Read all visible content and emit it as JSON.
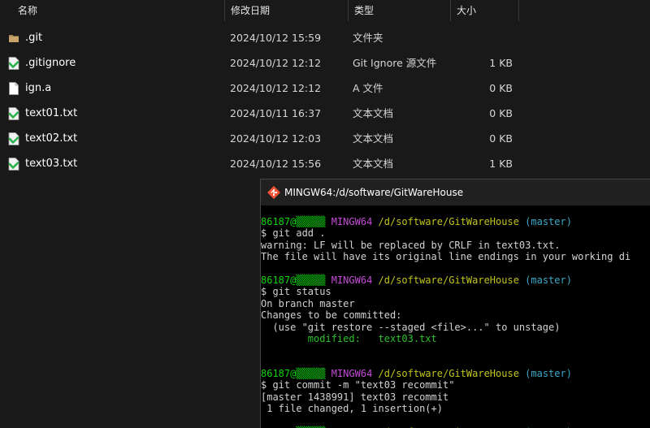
{
  "explorer": {
    "columns": {
      "name": "名称",
      "modified": "修改日期",
      "type": "类型",
      "size": "大小"
    },
    "sort_indicator": "^",
    "files": [
      {
        "name": ".git",
        "modified": "2024/10/12 15:59",
        "type": "文件夹",
        "size": "",
        "icon": "folder-icon"
      },
      {
        "name": ".gitignore",
        "modified": "2024/10/12 12:12",
        "type": "Git Ignore 源文件",
        "size": "1 KB",
        "icon": "git-file-icon"
      },
      {
        "name": "ign.a",
        "modified": "2024/10/12 12:12",
        "type": "A 文件",
        "size": "0 KB",
        "icon": "blank-file-icon"
      },
      {
        "name": "text01.txt",
        "modified": "2024/10/11 16:37",
        "type": "文本文档",
        "size": "0 KB",
        "icon": "git-file-icon"
      },
      {
        "name": "text02.txt",
        "modified": "2024/10/12 12:03",
        "type": "文本文档",
        "size": "0 KB",
        "icon": "git-file-icon"
      },
      {
        "name": "text03.txt",
        "modified": "2024/10/12 15:56",
        "type": "文本文档",
        "size": "1 KB",
        "icon": "git-file-icon"
      }
    ]
  },
  "terminal": {
    "title": "MINGW64:/d/software/GitWareHouse",
    "colors": {
      "user": "#0fd30f",
      "host": "#c34bd6",
      "path": "#c1c41a",
      "branch": "#3ba6c9",
      "text": "#d2d2d2",
      "staged": "#2cc02c"
    },
    "prompt": {
      "user": "86187@▒▒▒▒▒",
      "host": "MINGW64",
      "path": "/d/software/GitWareHouse",
      "branch": "(master)"
    },
    "lines": {
      "cmd1": "$ git add .",
      "warn1": "warning: LF will be replaced by CRLF in text03.txt.",
      "warn2": "The file will have its original line endings in your working di",
      "cmd2": "$ git status",
      "st1": "On branch master",
      "st2": "Changes to be committed:",
      "st3": "  (use \"git restore --staged <file>...\" to unstage)",
      "st4": "        modified:   text03.txt",
      "cmd3": "$ git commit -m \"text03 recommit\"",
      "cm1": "[master 1438991] text03 recommit",
      "cm2": " 1 file changed, 1 insertion(+)"
    }
  }
}
